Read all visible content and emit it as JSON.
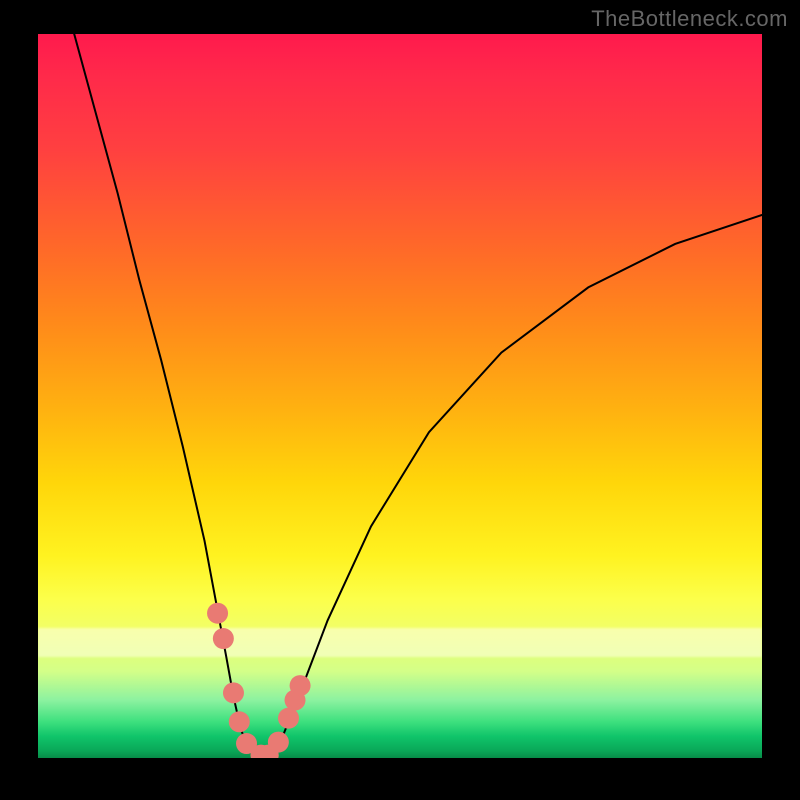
{
  "watermark": "TheBottleneck.com",
  "chart_data": {
    "type": "line",
    "title": "",
    "xlabel": "",
    "ylabel": "",
    "xlim": [
      0,
      100
    ],
    "ylim": [
      0,
      100
    ],
    "grid": false,
    "series": [
      {
        "name": "curve",
        "x": [
          5,
          8,
          11,
          14,
          17,
          20,
          23,
          24.5,
          26,
          27,
          28,
          29,
          30,
          31,
          32,
          33,
          34,
          36,
          40,
          46,
          54,
          64,
          76,
          88,
          100
        ],
        "y": [
          100,
          89,
          78,
          66,
          55,
          43,
          30,
          22,
          14,
          8.5,
          4,
          1.5,
          0.6,
          0.4,
          0.6,
          1.4,
          3.5,
          8.5,
          19,
          32,
          45,
          56,
          65,
          71,
          75
        ]
      }
    ],
    "markers": [
      {
        "x": 24.8,
        "y": 20.0
      },
      {
        "x": 25.6,
        "y": 16.5
      },
      {
        "x": 27.0,
        "y": 9.0
      },
      {
        "x": 27.8,
        "y": 5.0
      },
      {
        "x": 28.8,
        "y": 2.0
      },
      {
        "x": 30.8,
        "y": 0.4
      },
      {
        "x": 31.8,
        "y": 0.4
      },
      {
        "x": 33.2,
        "y": 2.2
      },
      {
        "x": 34.6,
        "y": 5.5
      },
      {
        "x": 35.5,
        "y": 8.0
      },
      {
        "x": 36.2,
        "y": 10.0
      }
    ],
    "marker_color": "#e97a73",
    "curve_color": "#000000"
  }
}
